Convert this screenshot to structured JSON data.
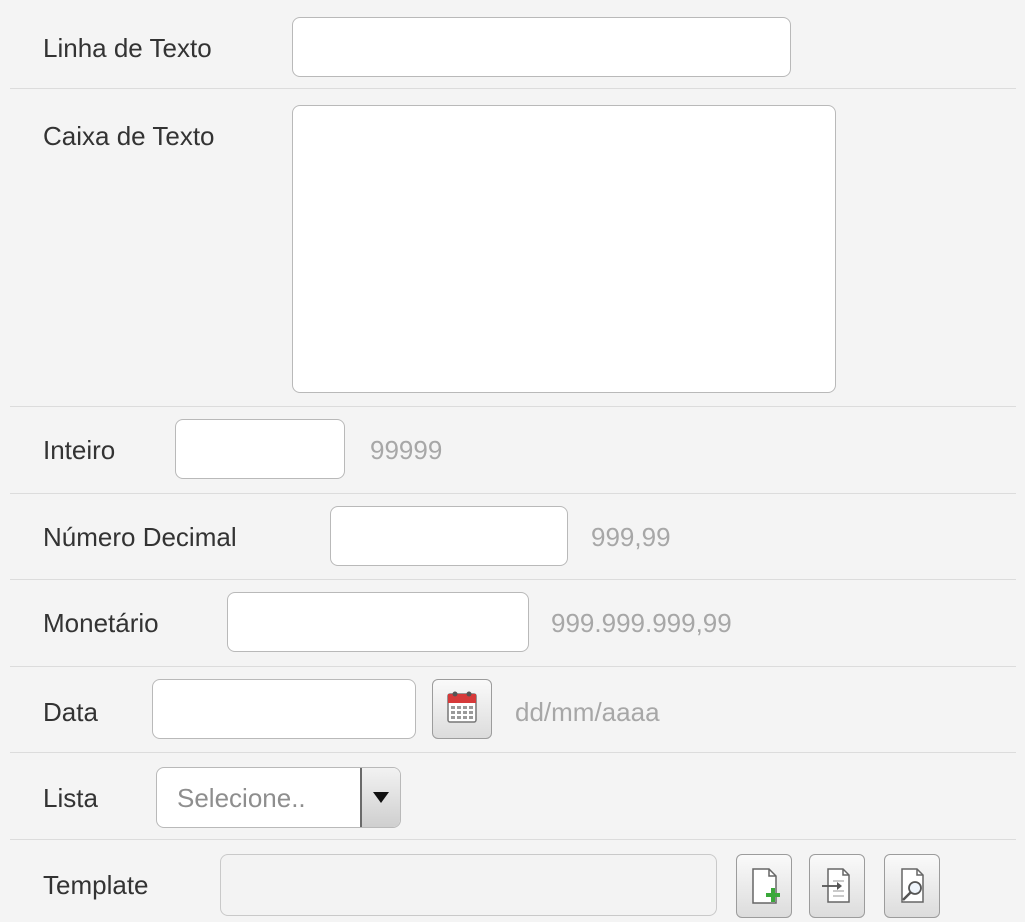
{
  "fields": {
    "linha": {
      "label": "Linha de Texto",
      "value": ""
    },
    "caixa": {
      "label": "Caixa de Texto",
      "value": ""
    },
    "inteiro": {
      "label": "Inteiro",
      "value": "",
      "hint": "99999"
    },
    "decimal": {
      "label": "Número Decimal",
      "value": "",
      "hint": "999,99"
    },
    "monetario": {
      "label": "Monetário",
      "value": "",
      "hint": "999.999.999,99"
    },
    "data": {
      "label": "Data",
      "value": "",
      "hint": "dd/mm/aaaa",
      "icon": "calendar-icon"
    },
    "lista": {
      "label": "Lista",
      "selected": "Selecione..",
      "icon": "dropdown-arrow-icon"
    },
    "template": {
      "label": "Template",
      "value": "",
      "buttons": [
        "new-document-icon",
        "import-document-icon",
        "view-document-icon"
      ]
    }
  },
  "colors": {
    "background": "#f4f4f4",
    "border": "#b9b9b9",
    "hint": "#a7a7a7",
    "accent_red": "#d63a3a",
    "accent_green": "#3aa83a"
  }
}
